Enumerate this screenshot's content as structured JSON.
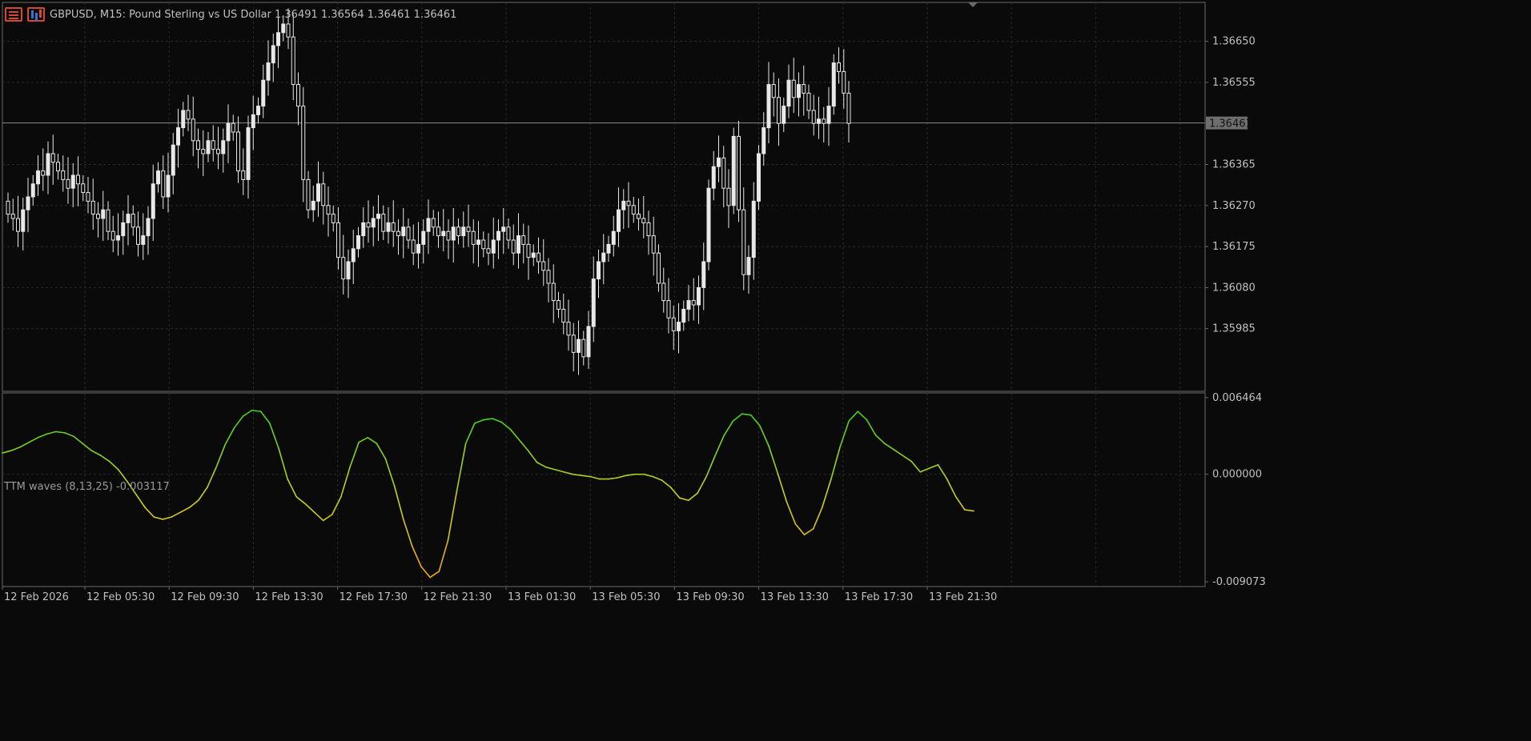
{
  "header": {
    "symbol_line": "GBPUSD, M15:  Pound Sterling vs US Dollar  1.36491 1.36564 1.36461 1.36461",
    "icons": [
      "menu-icon",
      "chart-bars-icon"
    ]
  },
  "colors": {
    "background": "#0a0a0a",
    "grid": "#2a2a2a",
    "axis_text": "#c0c0c0",
    "candle": "#e8e8e8",
    "price_line": "#8a8a8a",
    "wave_up": "#3ccf1e",
    "wave_down": "#f0a818"
  },
  "price_panel": {
    "current_price_label": "1.36461",
    "y_ticks": [
      "1.36650",
      "1.36555",
      "1.36365",
      "1.36270",
      "1.36175",
      "1.36080",
      "1.35985"
    ]
  },
  "indicator_panel": {
    "title": "TTM waves (8,13,25) -0.003117",
    "y_ticks": [
      "0.006464",
      "0.000000",
      "-0.009073"
    ]
  },
  "x_axis": {
    "labels": [
      "12 Feb 2026",
      "12 Feb 05:30",
      "12 Feb 09:30",
      "12 Feb 13:30",
      "12 Feb 17:30",
      "12 Feb 21:30",
      "13 Feb 01:30",
      "13 Feb 05:30",
      "13 Feb 09:30",
      "13 Feb 13:30",
      "13 Feb 17:30",
      "13 Feb 21:30"
    ]
  },
  "chart_data": [
    {
      "type": "candlestick",
      "symbol": "GBPUSD",
      "timeframe": "M15",
      "ylim": [
        1.3584,
        1.3674
      ],
      "current_price": 1.36461,
      "last_ohlc": {
        "open": 1.36491,
        "high": 1.36564,
        "low": 1.36461,
        "close": 1.36461
      },
      "close": [
        1.3625,
        1.3624,
        1.3621,
        1.3626,
        1.3629,
        1.3632,
        1.3635,
        1.3634,
        1.3639,
        1.3637,
        1.3635,
        1.3633,
        1.3631,
        1.3634,
        1.3632,
        1.363,
        1.3628,
        1.3625,
        1.3624,
        1.3626,
        1.3621,
        1.3619,
        1.362,
        1.3623,
        1.3625,
        1.3622,
        1.3618,
        1.362,
        1.3624,
        1.3632,
        1.3635,
        1.3629,
        1.3634,
        1.3641,
        1.3645,
        1.3649,
        1.3647,
        1.3642,
        1.364,
        1.3639,
        1.3642,
        1.364,
        1.3639,
        1.3642,
        1.3646,
        1.3644,
        1.3635,
        1.3633,
        1.3645,
        1.3648,
        1.365,
        1.3656,
        1.366,
        1.3664,
        1.3667,
        1.3669,
        1.3666,
        1.3655,
        1.365,
        1.3633,
        1.3626,
        1.3628,
        1.3632,
        1.3627,
        1.3625,
        1.3623,
        1.3615,
        1.361,
        1.3614,
        1.3617,
        1.362,
        1.3623,
        1.3622,
        1.3624,
        1.3625,
        1.3621,
        1.3623,
        1.3621,
        1.362,
        1.3622,
        1.3619,
        1.3616,
        1.3618,
        1.3621,
        1.3624,
        1.3622,
        1.362,
        1.3621,
        1.3619,
        1.3622,
        1.362,
        1.3622,
        1.3621,
        1.3618,
        1.3619,
        1.3617,
        1.3616,
        1.3619,
        1.3621,
        1.3622,
        1.3619,
        1.3616,
        1.362,
        1.3618,
        1.3615,
        1.3616,
        1.3614,
        1.3612,
        1.3609,
        1.3605,
        1.3603,
        1.36,
        1.3597,
        1.3593,
        1.3596,
        1.3592,
        1.3599,
        1.361,
        1.3614,
        1.3616,
        1.3618,
        1.3621,
        1.3626,
        1.3628,
        1.3627,
        1.3625,
        1.3624,
        1.3623,
        1.362,
        1.3616,
        1.3609,
        1.3605,
        1.3601,
        1.3598,
        1.36,
        1.3603,
        1.3605,
        1.3604,
        1.3608,
        1.3614,
        1.3631,
        1.3636,
        1.3638,
        1.3631,
        1.3627,
        1.3643,
        1.3626,
        1.3611,
        1.3615,
        1.3628,
        1.3639,
        1.3645,
        1.3655,
        1.3652,
        1.3646,
        1.365,
        1.3656,
        1.3652,
        1.3655,
        1.3653,
        1.3649,
        1.3646,
        1.3647,
        1.3646,
        1.365,
        1.366,
        1.3658,
        1.3653,
        1.3646
      ]
    },
    {
      "type": "line",
      "name": "TTM waves (8,13,25)",
      "ylim": [
        -0.009073,
        0.006464
      ],
      "last_value": -0.003117,
      "values": [
        0.0018,
        0.002,
        0.0023,
        0.0027,
        0.0031,
        0.0034,
        0.0036,
        0.0035,
        0.0032,
        0.0026,
        0.002,
        0.0016,
        0.0011,
        0.0004,
        -0.0006,
        -0.0017,
        -0.0028,
        -0.0036,
        -0.0038,
        -0.0036,
        -0.0032,
        -0.0028,
        -0.0022,
        -0.0011,
        0.0006,
        0.0025,
        0.0039,
        0.0049,
        0.0054,
        0.0053,
        0.0043,
        0.0022,
        -0.0004,
        -0.0019,
        -0.0025,
        -0.0032,
        -0.0039,
        -0.0034,
        -0.0019,
        0.0006,
        0.0027,
        0.0031,
        0.0026,
        0.0013,
        -0.001,
        -0.0038,
        -0.0061,
        -0.0078,
        -0.0087,
        -0.0082,
        -0.0056,
        -0.0014,
        0.0026,
        0.0043,
        0.0046,
        0.0047,
        0.0044,
        0.0038,
        0.0029,
        0.002,
        0.001,
        0.0006,
        0.0004,
        0.0002,
        0.0,
        -0.0001,
        -0.0002,
        -0.0004,
        -0.0004,
        -0.0003,
        -0.0001,
        0.0,
        0.0,
        -0.0002,
        -0.0005,
        -0.0011,
        -0.002,
        -0.0022,
        -0.0016,
        -0.0002,
        0.0016,
        0.0033,
        0.0045,
        0.0051,
        0.005,
        0.0041,
        0.0024,
        0.0001,
        -0.0023,
        -0.0042,
        -0.0051,
        -0.0046,
        -0.0028,
        -0.0004,
        0.0023,
        0.0045,
        0.0053,
        0.0046,
        0.0033,
        0.0026,
        0.0021,
        0.0016,
        0.0011,
        0.0002,
        0.0005,
        0.0008,
        -0.0004,
        -0.0019,
        -0.003,
        -0.0031
      ]
    }
  ]
}
